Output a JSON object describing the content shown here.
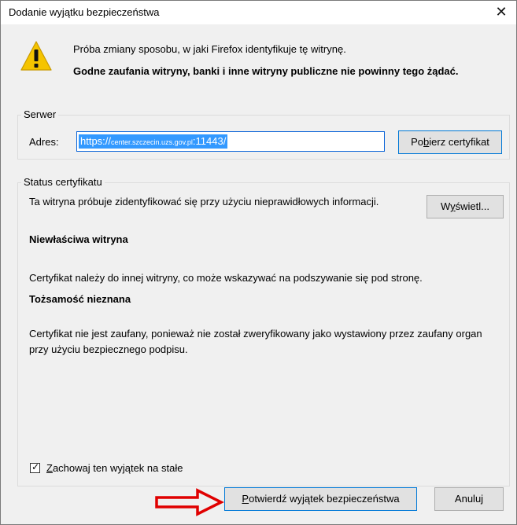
{
  "window": {
    "title": "Dodanie wyjątku bezpieczeństwa",
    "close_symbol": "✕"
  },
  "message": {
    "line1": "Próba zmiany sposobu, w jaki Firefox identyfikuje tę witrynę.",
    "line2": "Godne zaufania witryny, banki i inne witryny publiczne nie powinny tego żądać.",
    "icon": "warning-icon"
  },
  "server": {
    "legend": "Serwer",
    "address_label": "Adres:",
    "url_scheme": "https://",
    "url_host": "center.szczecin.uzs.gov.pl",
    "url_port_path": ":11443/",
    "fetch_button_pre": "Po",
    "fetch_button_accel": "b",
    "fetch_button_post": "ierz certyfikat"
  },
  "status": {
    "legend": "Status certyfikatu",
    "intro": "Ta witryna próbuje zidentyfikować się przy użyciu nieprawidłowych informacji.",
    "view_button_pre": "W",
    "view_button_accel": "y",
    "view_button_post": "świetl...",
    "wrong_site_heading": "Niewłaściwa witryna",
    "wrong_site_text": "Certyfikat należy do innej witryny, co może wskazywać na podszywanie się pod stronę.",
    "unknown_identity_heading": "Tożsamość nieznana",
    "unknown_identity_text": "Certyfikat nie jest zaufany, ponieważ nie został zweryfikowany jako wystawiony przez zaufany organ przy użyciu bezpiecznego podpisu."
  },
  "permanent": {
    "checked": true,
    "label_accel": "Z",
    "label_rest": "achowaj ten wyjątek na stałe"
  },
  "buttons": {
    "confirm_accel": "P",
    "confirm_rest": "otwierdź wyjątek bezpieczeństwa",
    "cancel": "Anuluj"
  },
  "colors": {
    "arrow": "#e00000",
    "selection": "#3399ff",
    "focus_border": "#0078d7"
  }
}
